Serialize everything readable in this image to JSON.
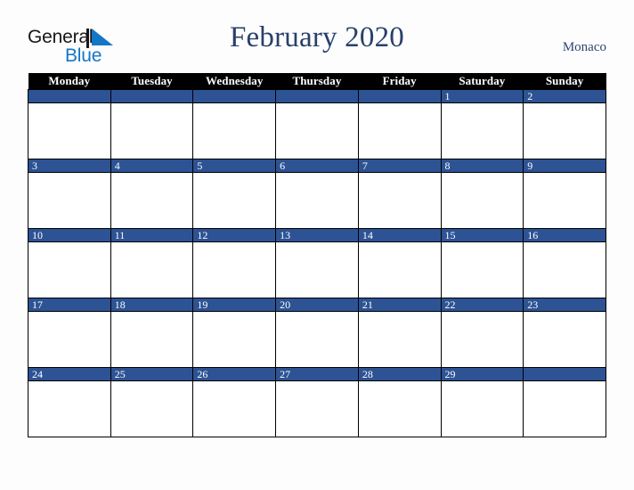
{
  "brand": {
    "name_part1": "General",
    "name_part2": "Blue",
    "mark_icon": "triangle-play-icon"
  },
  "header": {
    "title": "February 2020",
    "locale": "Monaco"
  },
  "calendar": {
    "month": "February",
    "year": "2020",
    "first_day_of_week": "Monday",
    "weekday_headers": [
      "Monday",
      "Tuesday",
      "Wednesday",
      "Thursday",
      "Friday",
      "Saturday",
      "Sunday"
    ],
    "colors": {
      "header_row_background": "#000000",
      "header_row_text": "#ffffff",
      "day_bar_background": "#2d5394",
      "day_bar_text": "#ffffff",
      "cell_background": "#ffffff",
      "grid_line": "#000000",
      "title_text": "#28406b",
      "locale_text": "#2e4570",
      "brand_blue": "#1476c6",
      "page_background": "#fdfdfd"
    },
    "weeks": [
      [
        "",
        "",
        "",
        "",
        "",
        "1",
        "2"
      ],
      [
        "3",
        "4",
        "5",
        "6",
        "7",
        "8",
        "9"
      ],
      [
        "10",
        "11",
        "12",
        "13",
        "14",
        "15",
        "16"
      ],
      [
        "17",
        "18",
        "19",
        "20",
        "21",
        "22",
        "23"
      ],
      [
        "24",
        "25",
        "26",
        "27",
        "28",
        "29",
        ""
      ]
    ]
  }
}
